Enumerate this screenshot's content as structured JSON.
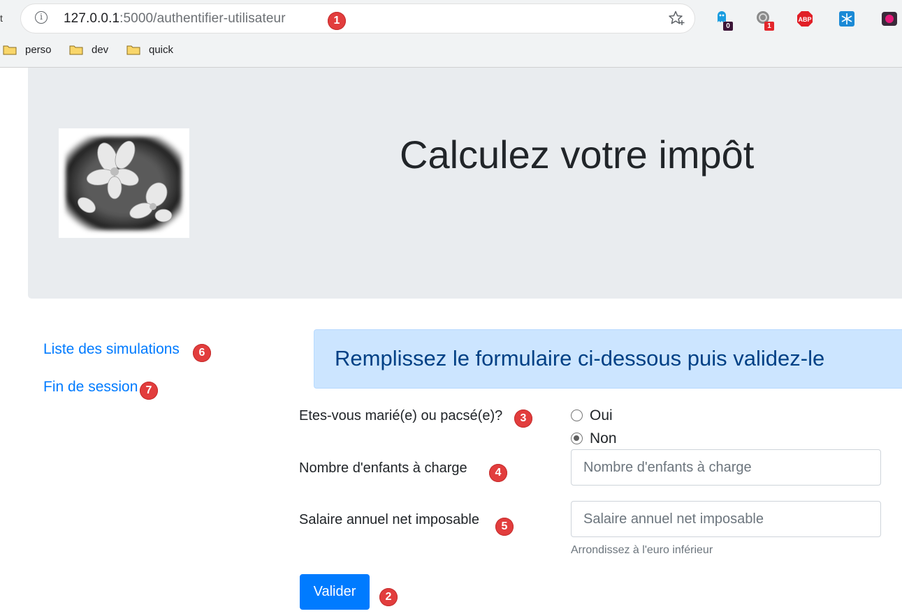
{
  "browser": {
    "url_host": "127.0.0.1",
    "url_path": ":5000/authentifier-utilisateur",
    "left_edge_glyph": "t",
    "bookmarks": [
      {
        "label": "perso",
        "icon": "folder-icon"
      },
      {
        "label": "dev",
        "icon": "folder-icon"
      },
      {
        "label": "quick",
        "icon": "folder-icon"
      }
    ],
    "extensions": [
      {
        "icon": "ghost-extension-icon",
        "badge": "0"
      },
      {
        "icon": "privacy-extension-icon",
        "badge": "1"
      },
      {
        "icon": "adblock-plus-icon",
        "label": "ABP"
      },
      {
        "icon": "snowflake-extension-icon"
      },
      {
        "icon": "record-extension-icon"
      }
    ]
  },
  "header": {
    "title": "Calculez votre impôt",
    "logo": "flower-logo-image"
  },
  "nav": {
    "links": [
      {
        "label": "Liste des simulations"
      },
      {
        "label": "Fin de session"
      }
    ]
  },
  "alert": {
    "text": "Remplissez le formulaire ci-dessous puis validez-le"
  },
  "form": {
    "married_label": "Etes-vous marié(e) ou pacsé(e)?",
    "married_options": [
      {
        "label": "Oui",
        "checked": false
      },
      {
        "label": "Non",
        "checked": true
      }
    ],
    "children_label": "Nombre d'enfants à charge",
    "children_placeholder": "Nombre d'enfants à charge",
    "children_value": "",
    "salary_label": "Salaire annuel net imposable",
    "salary_placeholder": "Salaire annuel net imposable",
    "salary_value": "",
    "salary_help": "Arrondissez à l'euro inférieur",
    "submit_label": "Valider"
  },
  "markers": [
    "1",
    "2",
    "3",
    "4",
    "5",
    "6",
    "7"
  ],
  "colors": {
    "primary": "#007bff",
    "jumbotron_bg": "#e9ecef",
    "alert_bg": "#cce5ff",
    "alert_text": "#004085",
    "marker": "#e23d3d"
  }
}
